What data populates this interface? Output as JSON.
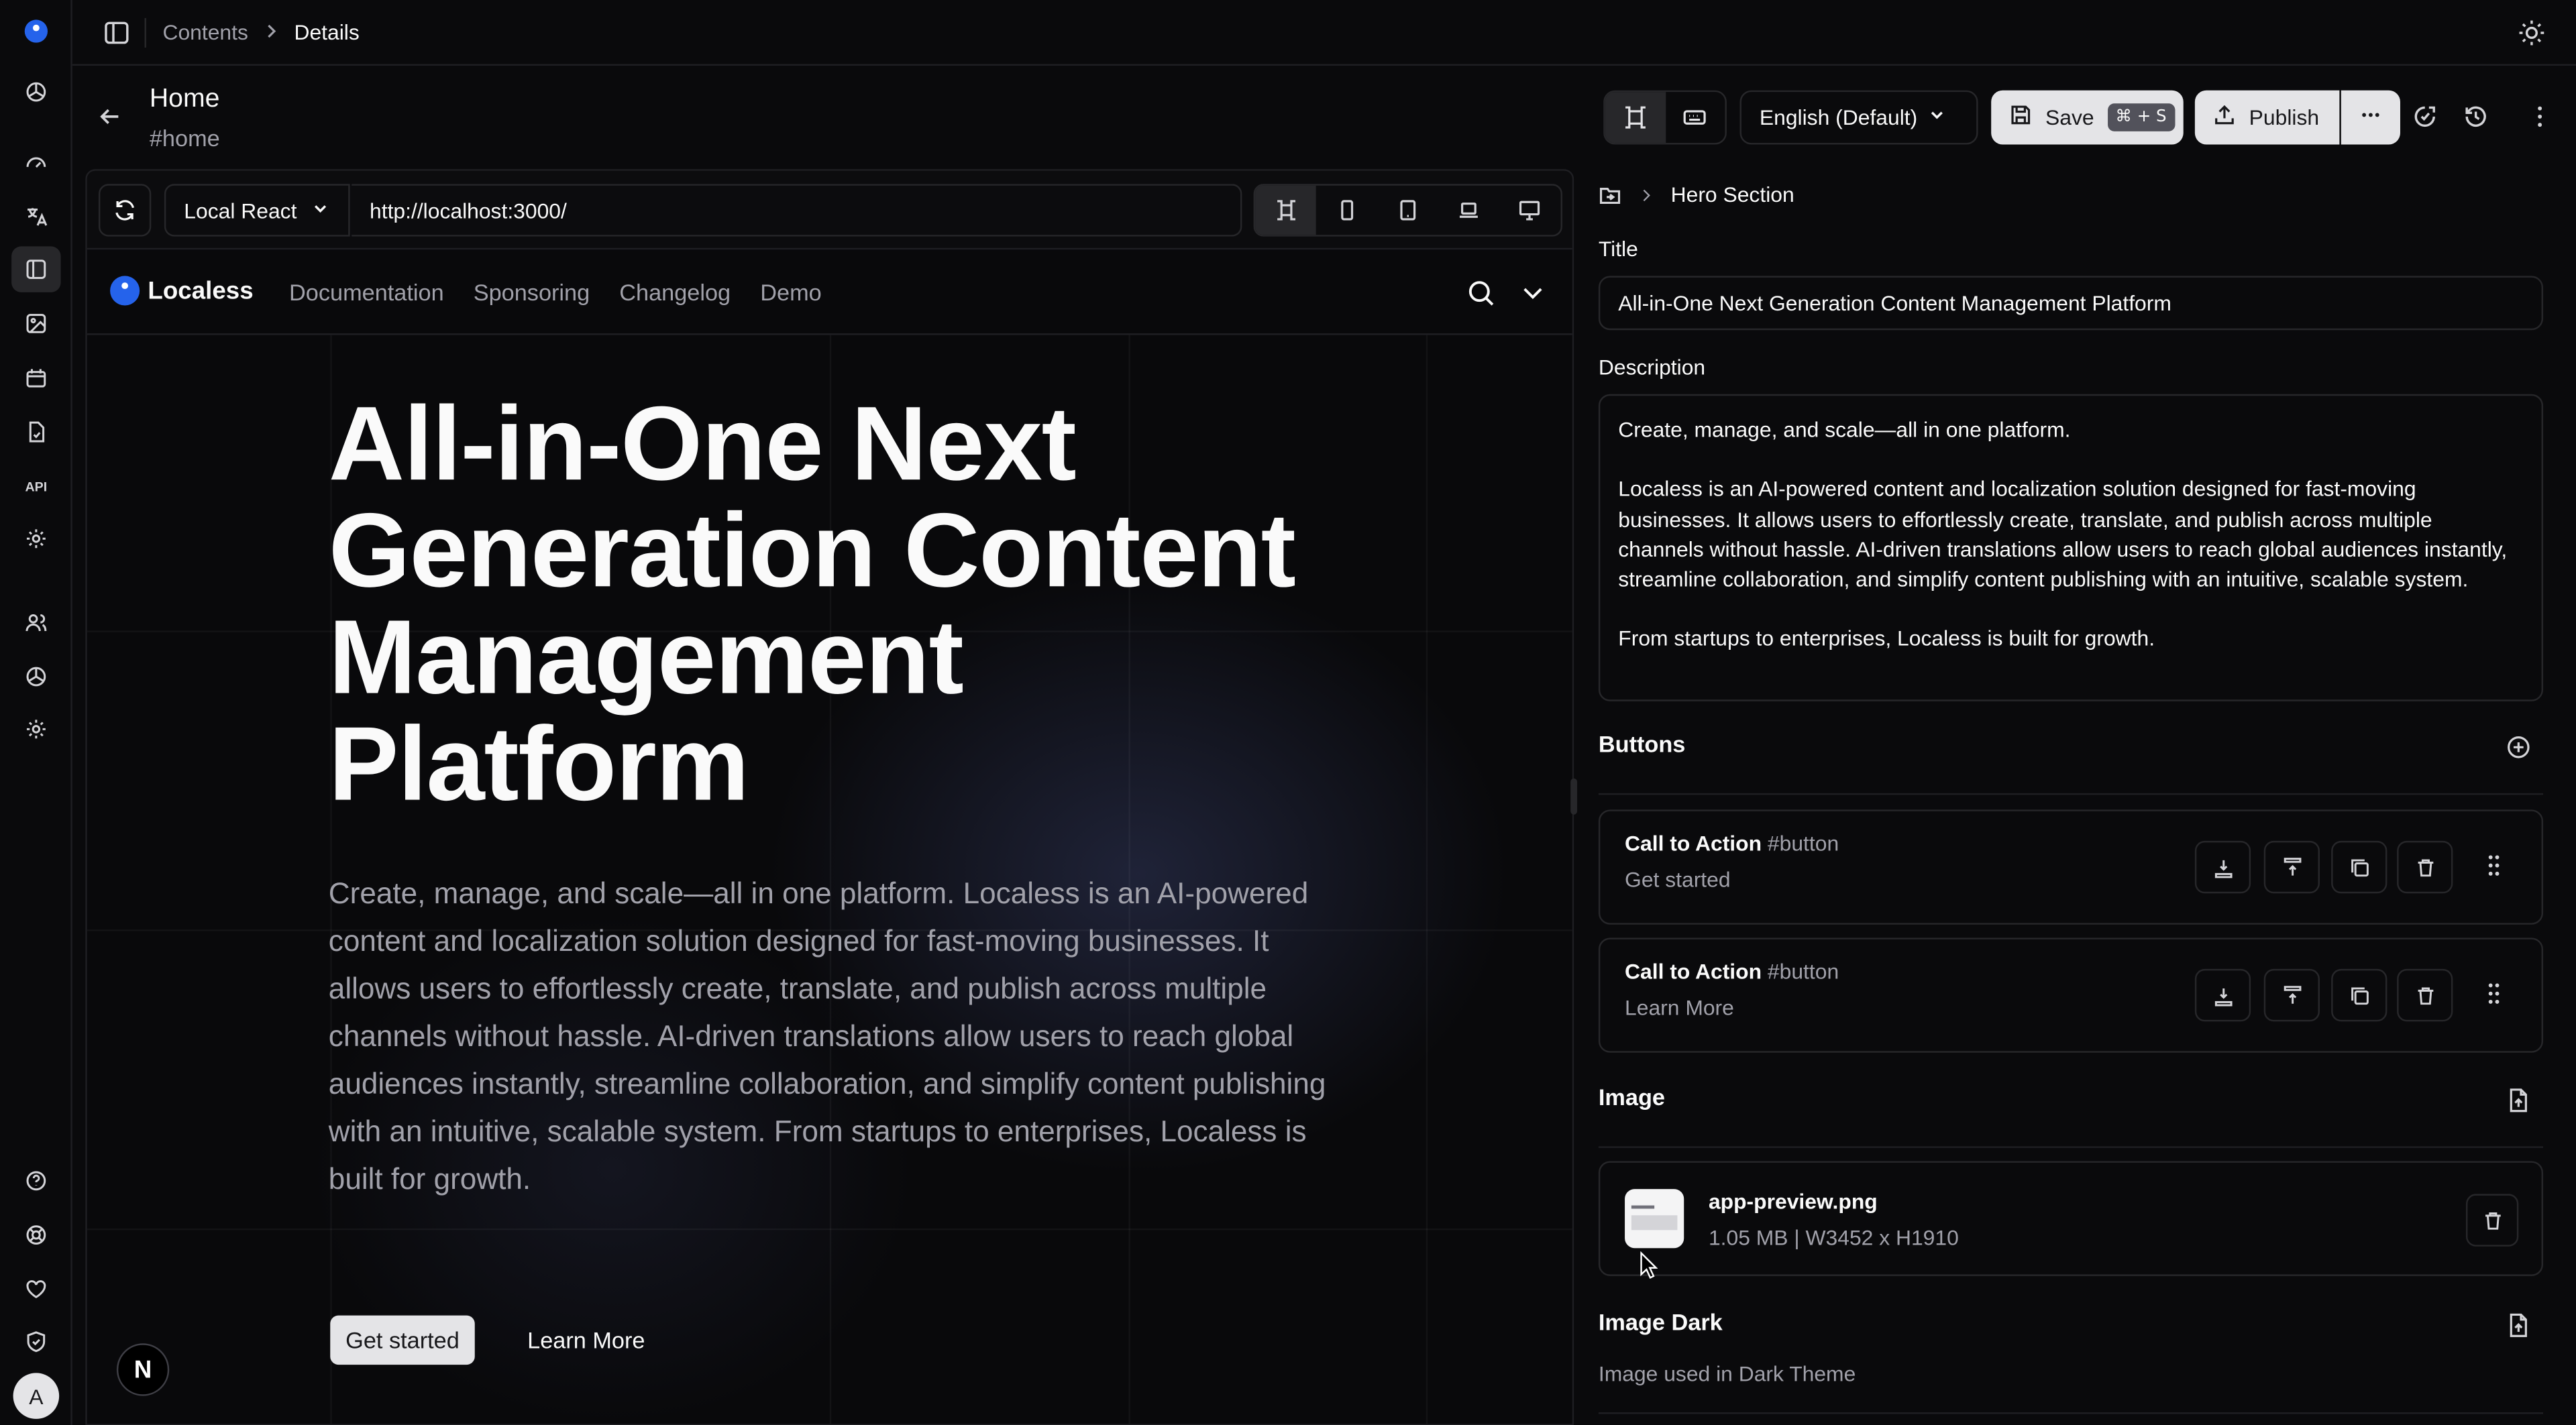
{
  "breadcrumb": {
    "parent": "Contents",
    "current": "Details"
  },
  "page": {
    "title": "Home",
    "slug": "#home"
  },
  "toolbar": {
    "language": "English (Default)",
    "save_label": "Save",
    "save_shortcut": "⌘ + S",
    "publish_label": "Publish"
  },
  "preview": {
    "framework": "Local React",
    "url": "http://localhost:3000/",
    "site": {
      "brand": "Localess",
      "nav": [
        "Documentation",
        "Sponsoring",
        "Changelog",
        "Demo"
      ],
      "hero_title": "All-in-One Next Generation Content Management Platform",
      "hero_desc": "Create, manage, and scale—all in one platform. Localess is an AI-powered content and localization solution designed for fast-moving businesses. It allows users to effortlessly create, translate, and publish across multiple channels without hassle. AI-driven translations allow users to reach global audiences instantly, streamline collaboration, and simplify content publishing with an intuitive, scalable system. From startups to enterprises, Localess is built for growth.",
      "cta_primary": "Get started",
      "cta_secondary": "Learn More",
      "badge": "N"
    }
  },
  "editor": {
    "section": "Hero Section",
    "title_label": "Title",
    "title_value": "All-in-One Next Generation Content Management Platform",
    "description_label": "Description",
    "description_value": "Create, manage, and scale—all in one platform.\n\nLocaless is an AI-powered content and localization solution designed for fast-moving businesses. It allows users to effortlessly create, translate, and publish across multiple channels without hassle. AI-driven translations allow users to reach global audiences instantly, streamline collaboration, and simplify content publishing with an intuitive, scalable system.\n\nFrom startups to enterprises, Localess is built for growth.",
    "buttons_label": "Buttons",
    "buttons": [
      {
        "title": "Call to Action",
        "tag": "#button",
        "value": "Get started"
      },
      {
        "title": "Call to Action",
        "tag": "#button",
        "value": "Learn More"
      }
    ],
    "image_label": "Image",
    "image": {
      "name": "app-preview.png",
      "meta": "1.05 MB | W3452 x H1910"
    },
    "image_dark_label": "Image Dark",
    "image_dark_hint": "Image used in Dark Theme"
  },
  "user": {
    "initial": "A"
  },
  "colors": {
    "accent": "#2563eb",
    "background": "#0a0a0c",
    "border": "#27272a"
  },
  "icons": [
    "search-icon",
    "gear-icon",
    "translate-icon",
    "image-icon",
    "users-icon",
    "help-icon",
    "sun-icon",
    "history-icon",
    "trash-icon",
    "copy-icon",
    "drag-handle-icon"
  ]
}
